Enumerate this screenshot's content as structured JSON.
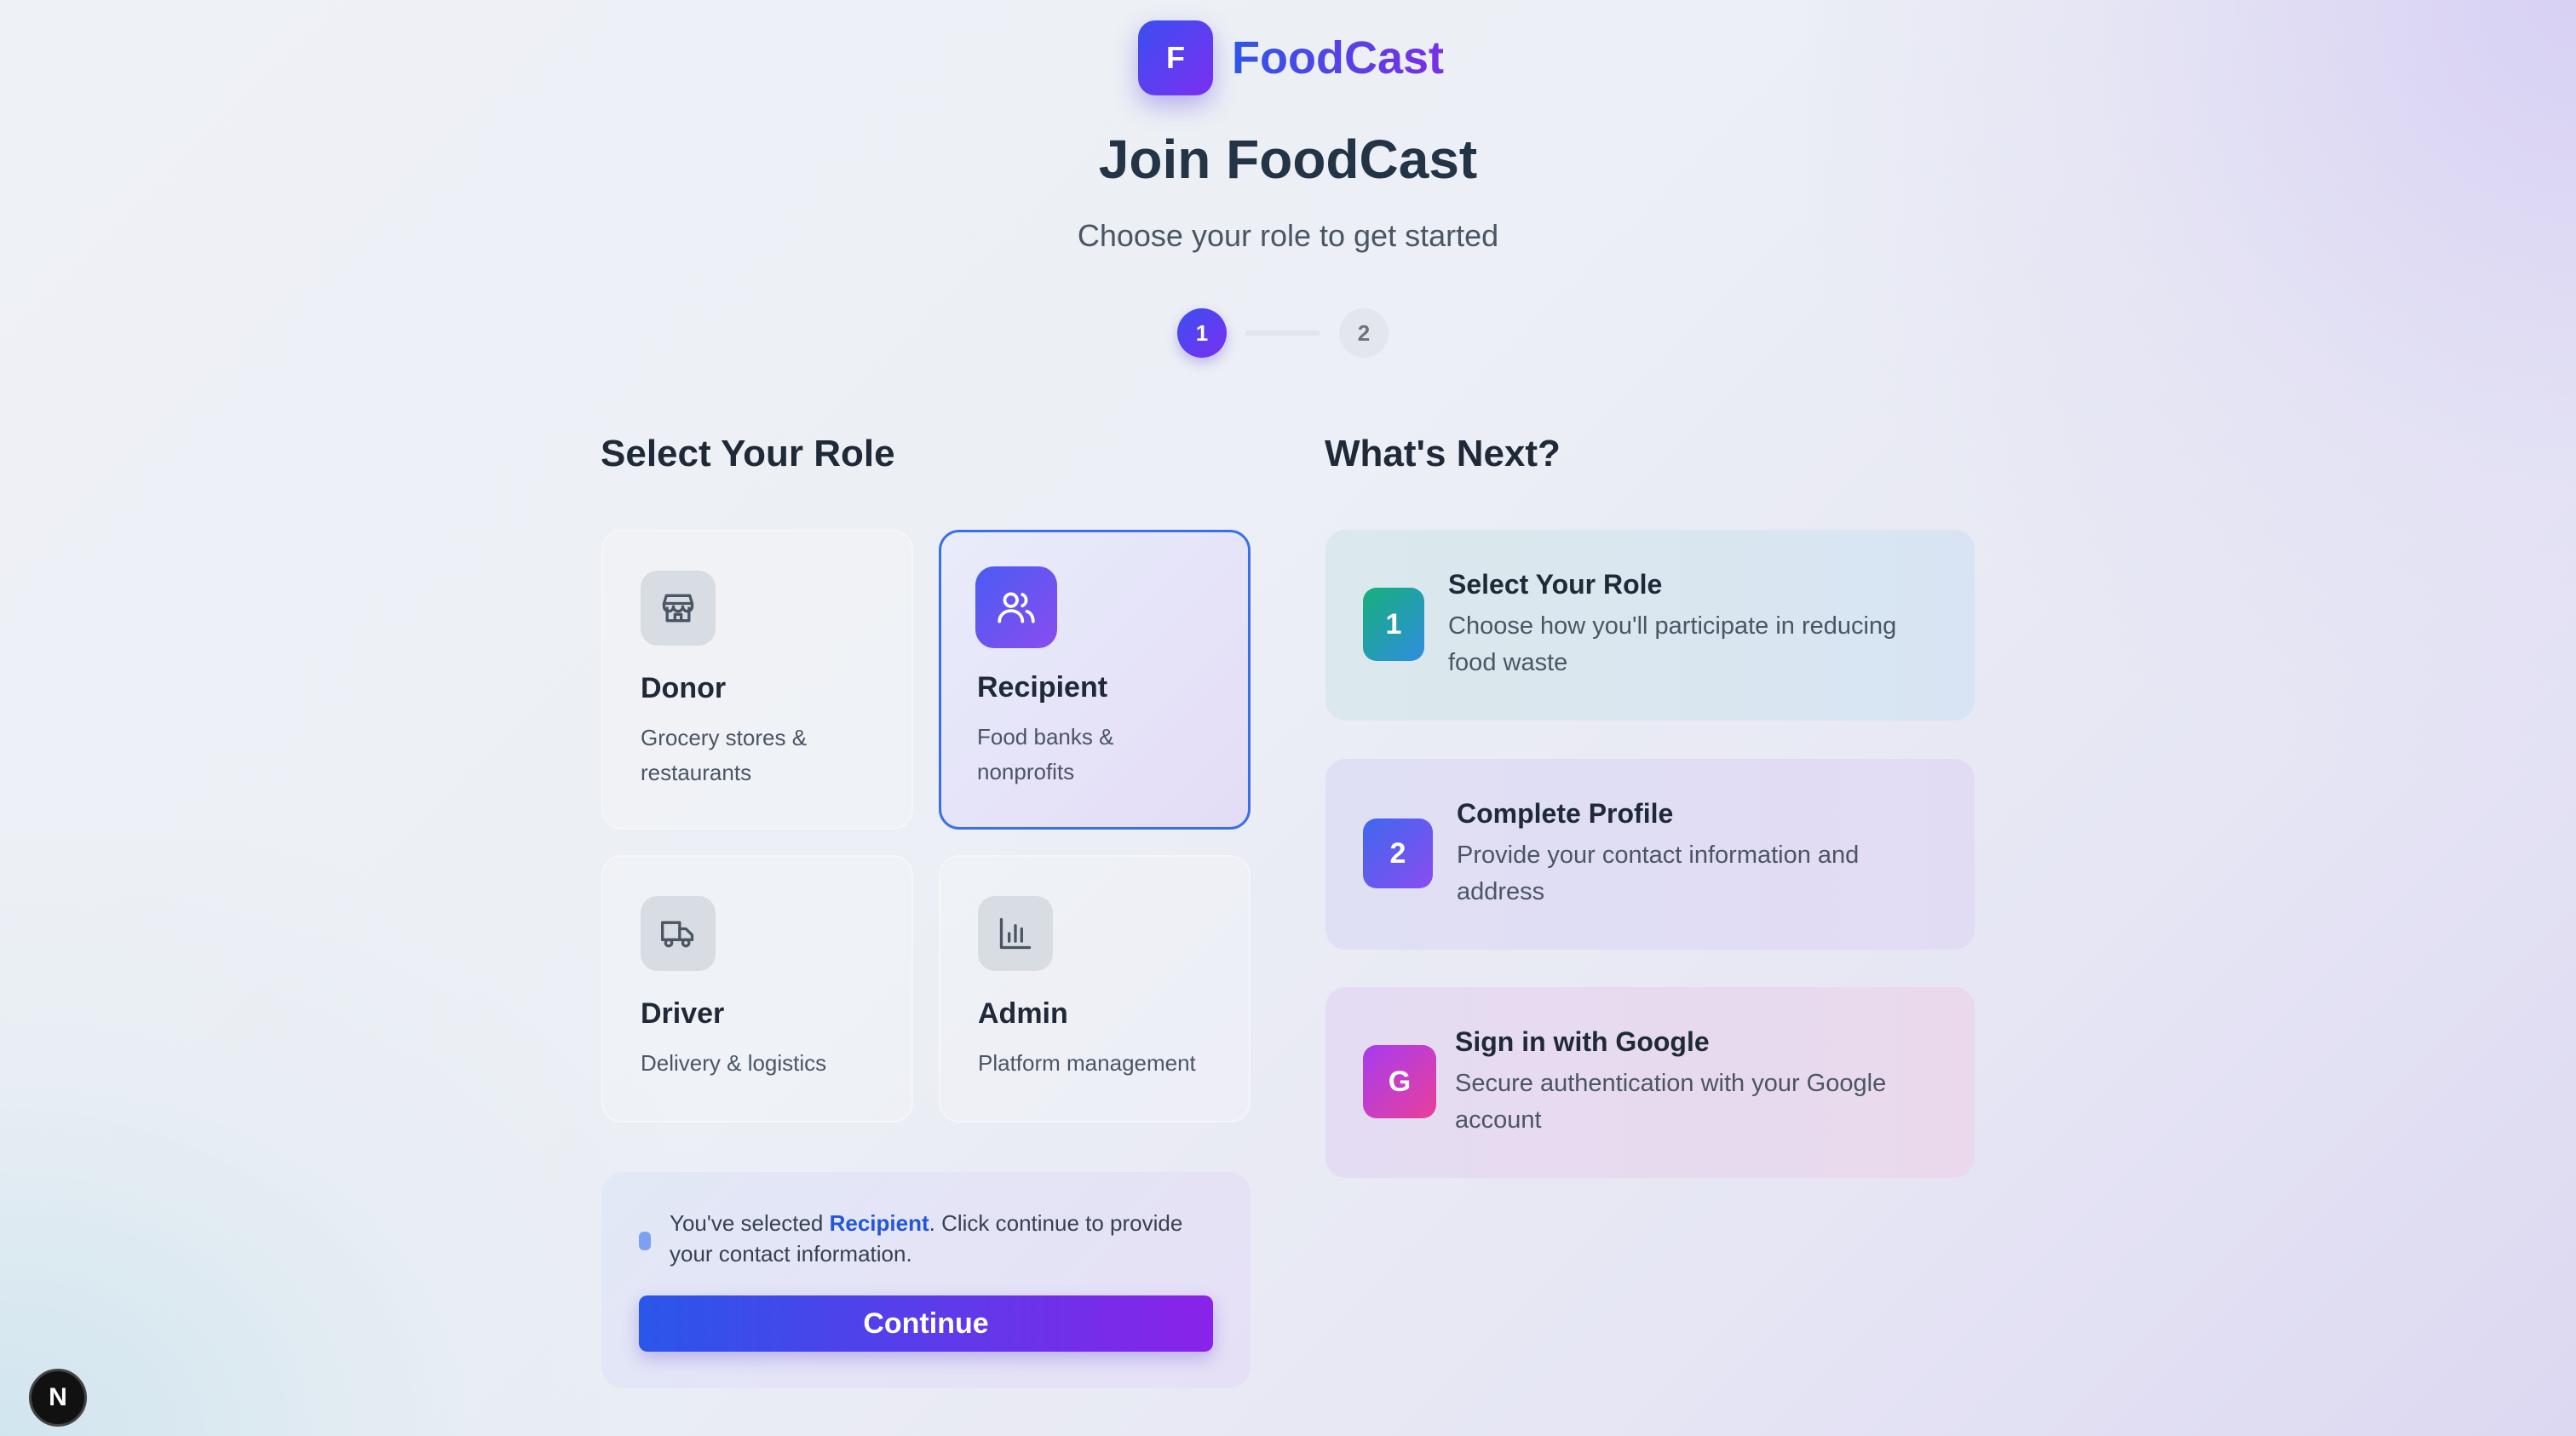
{
  "brand": {
    "logo_letter": "F",
    "name": "FoodCast"
  },
  "header": {
    "title": "Join FoodCast",
    "subtitle": "Choose your role to get started"
  },
  "stepper": {
    "steps": [
      "1",
      "2"
    ],
    "current": 1
  },
  "roles_section": {
    "title": "Select Your Role",
    "roles": [
      {
        "name": "Donor",
        "description": "Grocery stores & restaurants",
        "icon": "store-icon",
        "selected": false
      },
      {
        "name": "Recipient",
        "description": "Food banks & nonprofits",
        "icon": "users-icon",
        "selected": true
      },
      {
        "name": "Driver",
        "description": "Delivery & logistics",
        "icon": "truck-icon",
        "selected": false
      },
      {
        "name": "Admin",
        "description": "Platform management",
        "icon": "bar-chart-icon",
        "selected": false
      }
    ]
  },
  "selection": {
    "prefix": "You've selected ",
    "role": "Recipient",
    "suffix": ". Click continue to provide your contact information.",
    "button_label": "Continue"
  },
  "next_section": {
    "title": "What's Next?",
    "steps": [
      {
        "number": "1",
        "title": "Select Your Role",
        "description": "Choose how you'll participate in reducing food waste"
      },
      {
        "number": "2",
        "title": "Complete Profile",
        "description": "Provide your contact information and address"
      },
      {
        "number": "G",
        "title": "Sign in with Google",
        "description": "Secure authentication with your Google account"
      }
    ]
  },
  "dev_badge": "N",
  "colors": {
    "primary_start": "#3b4ff0",
    "primary_end": "#7b2ff0",
    "selected_border": "#3b6fe8",
    "selected_text": "#2456d6"
  }
}
